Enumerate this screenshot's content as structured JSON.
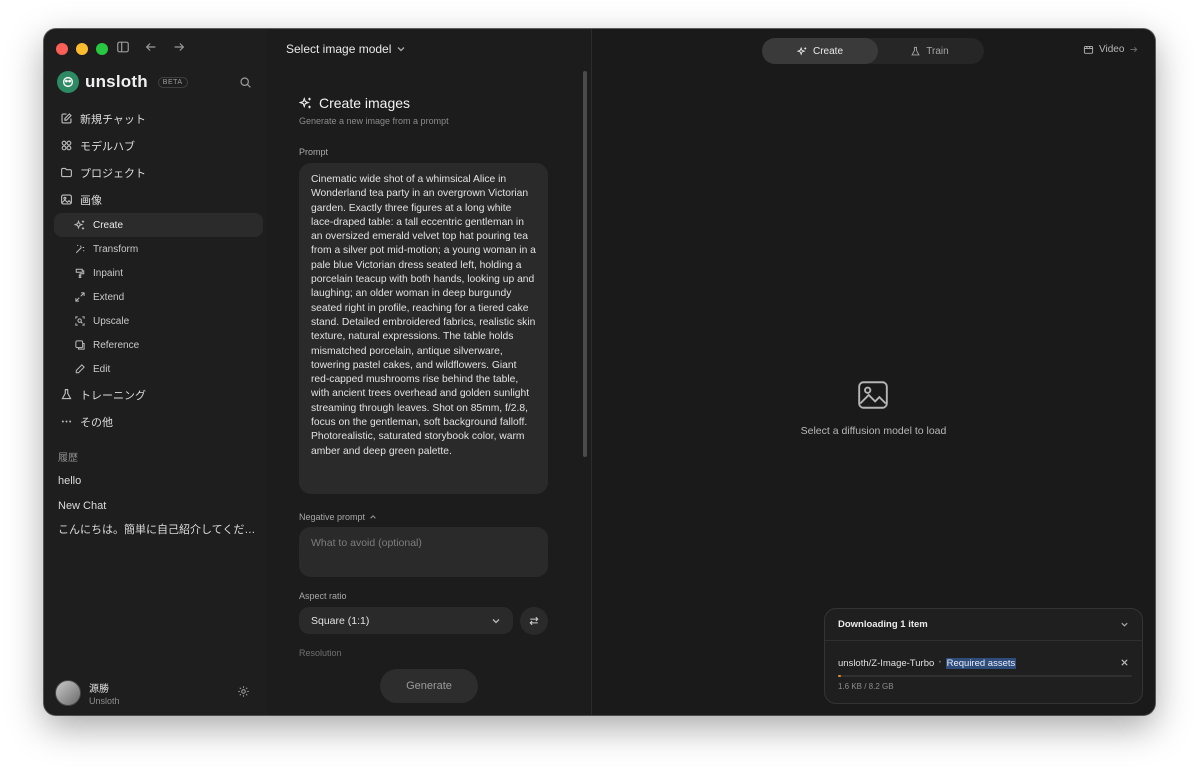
{
  "app": {
    "brand": "unsloth",
    "badge": "BETA"
  },
  "nav": {
    "items": [
      {
        "label": "新規チャット",
        "icon": "new-chat-icon"
      },
      {
        "label": "モデルハブ",
        "icon": "model-hub-icon"
      },
      {
        "label": "プロジェクト",
        "icon": "folder-icon"
      },
      {
        "label": "画像",
        "icon": "image-icon"
      }
    ],
    "image_sub": [
      {
        "label": "Create",
        "icon": "sparkle-icon"
      },
      {
        "label": "Transform",
        "icon": "wand-icon"
      },
      {
        "label": "Inpaint",
        "icon": "brush-icon"
      },
      {
        "label": "Extend",
        "icon": "expand-icon"
      },
      {
        "label": "Upscale",
        "icon": "upscale-icon"
      },
      {
        "label": "Reference",
        "icon": "reference-icon"
      },
      {
        "label": "Edit",
        "icon": "pencil-icon"
      }
    ],
    "training": {
      "label": "トレーニング",
      "icon": "flask-icon"
    },
    "more": {
      "label": "その他",
      "icon": "more-icon"
    }
  },
  "history": {
    "title": "履歴",
    "items": [
      "hello",
      "New Chat",
      "こんにちは。簡単に自己紹介してくださ…"
    ]
  },
  "user": {
    "name": "源勝",
    "org": "Unsloth"
  },
  "header": {
    "model_select": "Select image model"
  },
  "form": {
    "title": "Create images",
    "subtitle": "Generate a new image from a prompt",
    "prompt_label": "Prompt",
    "prompt_value": "Cinematic wide shot of a whimsical Alice in Wonderland tea party in an overgrown Victorian garden. Exactly three figures at a long white lace-draped table: a tall eccentric gentleman in an oversized emerald velvet top hat pouring tea from a silver pot mid-motion; a young woman in a pale blue Victorian dress seated left, holding a porcelain teacup with both hands, looking up and laughing; an older woman in deep burgundy seated right in profile, reaching for a tiered cake stand. Detailed embroidered fabrics, realistic skin texture, natural expressions. The table holds mismatched porcelain, antique silverware, towering pastel cakes, and wildflowers. Giant red-capped mushrooms rise behind the table, with ancient trees overhead and golden sunlight streaming through leaves. Shot on 85mm, f/2.8, focus on the gentleman, soft background falloff. Photorealistic, saturated storybook color, warm amber and deep green palette.",
    "negative_label": "Negative prompt",
    "negative_placeholder": "What to avoid (optional)",
    "aspect_label": "Aspect ratio",
    "aspect_value": "Square (1:1)",
    "resolution_label": "Resolution",
    "generate_label": "Generate"
  },
  "tabs": {
    "create": "Create",
    "train": "Train",
    "video": "Video"
  },
  "canvas": {
    "empty_text": "Select a diffusion model to load"
  },
  "download": {
    "title": "Downloading 1 item",
    "repo": "unsloth/Z-Image-Turbo",
    "separator": "·",
    "tag": "Required assets",
    "size": "1.6 KB / 8.2 GB",
    "progress": 0.008
  },
  "colors": {
    "window_bg": "#1a1a1a",
    "sidebar_bg": "#1e1e1e",
    "accent_progress": "#e08a30",
    "brand_logo": "#2d8a63"
  }
}
